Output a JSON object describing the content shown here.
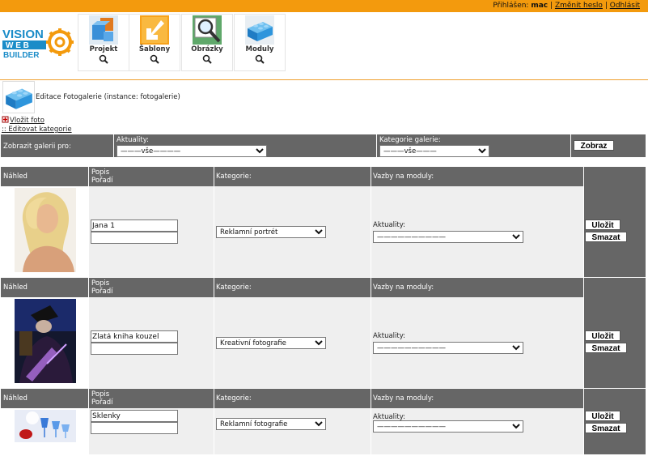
{
  "topbar": {
    "logged_label": "Přihlášen:",
    "user": "mac",
    "change_password": "Změnit heslo",
    "sep": "|",
    "logout": "Odhlásit"
  },
  "logo": {
    "line1": "VISION",
    "line2": "W E B",
    "line3": "BUILDER"
  },
  "nav": [
    {
      "label": "Projekt",
      "icon": "cubes-icon"
    },
    {
      "label": "Šablony",
      "icon": "arrow-icon"
    },
    {
      "label": "Obrázky",
      "icon": "image-zoom-icon"
    },
    {
      "label": "Moduly",
      "icon": "lego-brick-icon"
    }
  ],
  "module": {
    "title": "Editace Fotogalerie (instance: fotogalerie)"
  },
  "links": {
    "add_photo": "Vložit foto",
    "edit_categories": ":: Editovat kategorie"
  },
  "filter": {
    "label": "Zobrazit galerii pro:",
    "news_label": "Aktuality:",
    "news_value": "———vše————",
    "category_label": "Kategorie galerie:",
    "category_value": "———vše———",
    "show_button": "Zobraz"
  },
  "columns": {
    "preview": "Náhled",
    "desc": "Popis",
    "order": "Pořadí",
    "category": "Kategorie:",
    "links": "Vazby na moduly:"
  },
  "row_labels": {
    "news": "Aktuality:",
    "news_value": "——————————",
    "save": "Uložit",
    "delete": "Smazat"
  },
  "photos": [
    {
      "desc": "Jana 1",
      "order": "",
      "category": "Reklamní portrét",
      "thumb": "portrait"
    },
    {
      "desc": "Zlatá kniha kouzel",
      "order": "",
      "category": "Kreativní fotografie",
      "thumb": "magic"
    },
    {
      "desc": "Sklenky",
      "order": "",
      "category": "Reklamní fotografie",
      "thumb": "glasses"
    }
  ],
  "colors": {
    "topbar": "#f39a0d",
    "header_gray": "#666666",
    "row_bg": "#efefef"
  }
}
